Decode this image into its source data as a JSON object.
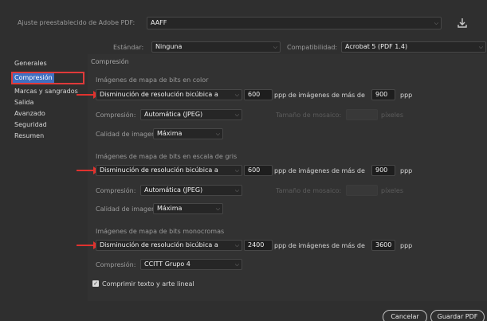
{
  "header": {
    "preset_label": "Ajuste preestablecido de Adobe PDF:",
    "preset_value": "AAFF",
    "standard_label": "Estándar:",
    "standard_value": "Ninguna",
    "compat_label": "Compatibilidad:",
    "compat_value": "Acrobat 5 (PDF 1.4)"
  },
  "sidebar": {
    "items": [
      {
        "label": "Generales"
      },
      {
        "label": "Compresión"
      },
      {
        "label": "Marcas y sangrados"
      },
      {
        "label": "Salida"
      },
      {
        "label": "Avanzado"
      },
      {
        "label": "Seguridad"
      },
      {
        "label": "Resumen"
      }
    ],
    "selected_index": 1
  },
  "main": {
    "section_title": "Compresión",
    "color": {
      "title": "Imágenes de mapa de bits en color",
      "method": "Disminución de resolución bicúbica a",
      "ppi": "600",
      "above_text": "ppp de imágenes de más de",
      "above_value": "900",
      "unit": "ppp",
      "compression_label": "Compresión:",
      "compression_value": "Automática (JPEG)",
      "tile_label": "Tamaño de mosaico:",
      "tile_unit": "píxeles",
      "quality_label": "Calidad de imagen:",
      "quality_value": "Máxima"
    },
    "gray": {
      "title": "Imágenes de mapa de bits en escala de gris",
      "method": "Disminución de resolución bicúbica a",
      "ppi": "600",
      "above_text": "ppp de imágenes de más de",
      "above_value": "900",
      "unit": "ppp",
      "compression_label": "Compresión:",
      "compression_value": "Automática (JPEG)",
      "tile_label": "Tamaño de mosaico:",
      "tile_unit": "píxeles",
      "quality_label": "Calidad de imagen:",
      "quality_value": "Máxima"
    },
    "mono": {
      "title": "Imágenes de mapa de bits monocromas",
      "method": "Disminución de resolución bicúbica a",
      "ppi": "2400",
      "above_text": "ppp de imágenes de más de",
      "above_value": "3600",
      "unit": "ppp",
      "compression_label": "Compresión:",
      "compression_value": "CCITT Grupo 4"
    },
    "compress_text_label": "Comprimir texto y arte lineal",
    "compress_text_checked": true
  },
  "footer": {
    "cancel_label": "Cancelar",
    "save_label": "Guardar PDF"
  },
  "icons": {
    "save_preset": "save-preset-icon"
  },
  "colors": {
    "selection": "#3f6fc1",
    "annotation": "#e0322e"
  }
}
